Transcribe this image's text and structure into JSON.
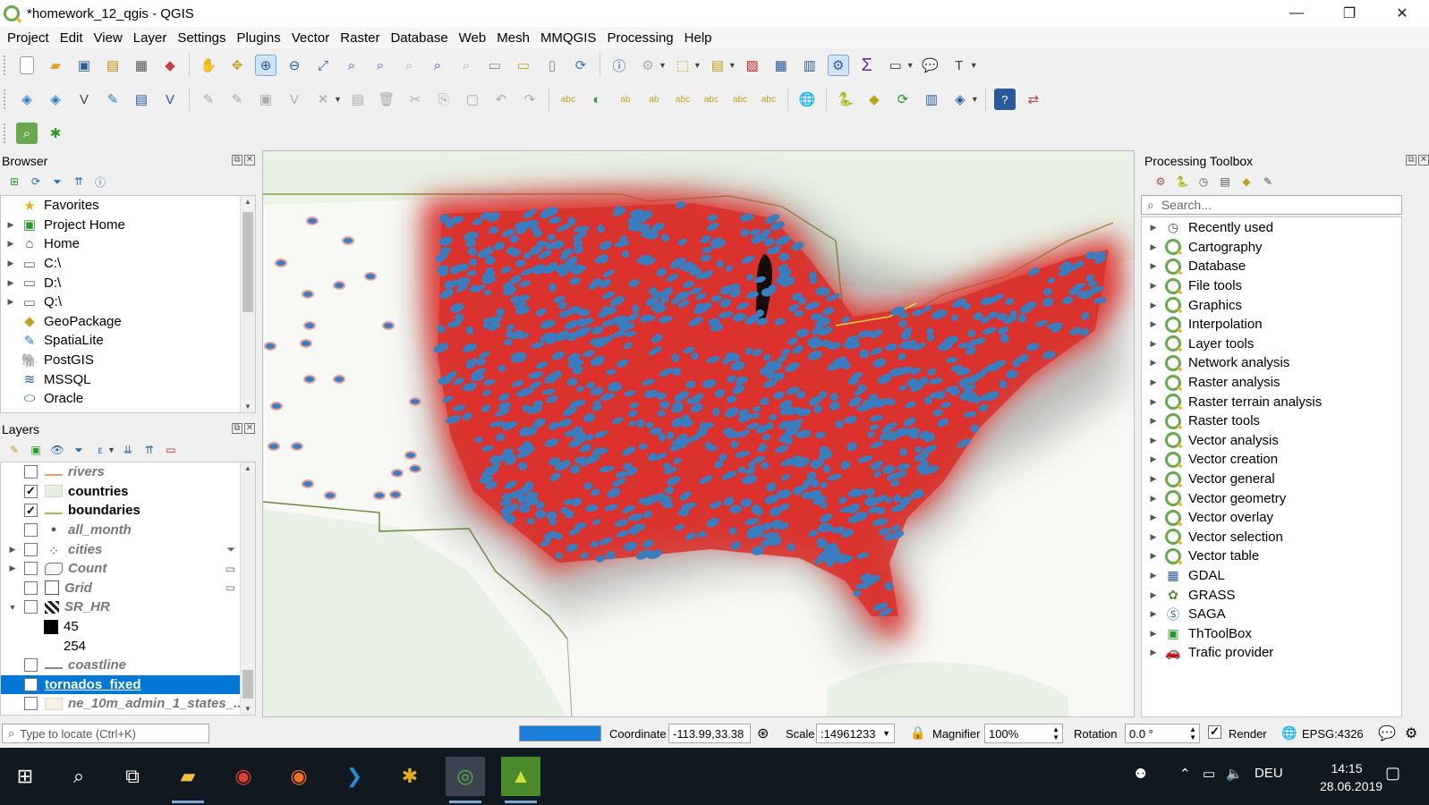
{
  "window": {
    "title": "*homework_12_qgis - QGIS",
    "minimize": "—",
    "maximize": "❐",
    "close": "✕"
  },
  "menu": [
    "Project",
    "Edit",
    "View",
    "Layer",
    "Settings",
    "Plugins",
    "Vector",
    "Raster",
    "Database",
    "Web",
    "Mesh",
    "MMQGIS",
    "Processing",
    "Help"
  ],
  "browser": {
    "title": "Browser",
    "items": [
      {
        "label": "Favorites",
        "icon": "star-icon",
        "expand": false
      },
      {
        "label": "Project Home",
        "icon": "project-home-icon",
        "expand": true
      },
      {
        "label": "Home",
        "icon": "home-icon",
        "expand": true
      },
      {
        "label": "C:\\",
        "icon": "folder-icon",
        "expand": true
      },
      {
        "label": "D:\\",
        "icon": "folder-icon",
        "expand": true
      },
      {
        "label": "Q:\\",
        "icon": "folder-icon",
        "expand": true
      },
      {
        "label": "GeoPackage",
        "icon": "geopackage-icon",
        "expand": false
      },
      {
        "label": "SpatiaLite",
        "icon": "spatialite-icon",
        "expand": false
      },
      {
        "label": "PostGIS",
        "icon": "postgis-icon",
        "expand": false
      },
      {
        "label": "MSSQL",
        "icon": "mssql-icon",
        "expand": false
      },
      {
        "label": "Oracle",
        "icon": "oracle-icon",
        "expand": false
      }
    ]
  },
  "layers": {
    "title": "Layers",
    "items": [
      {
        "label": "rivers",
        "checked": false,
        "style": "italic",
        "sym": "line-orange"
      },
      {
        "label": "countries",
        "checked": true,
        "style": "bold",
        "sym": "fill-green"
      },
      {
        "label": "boundaries",
        "checked": true,
        "style": "bold",
        "sym": "line-olive"
      },
      {
        "label": "all_month",
        "checked": false,
        "style": "italic",
        "sym": "point-gray"
      },
      {
        "label": "cities",
        "checked": false,
        "style": "italic",
        "sym": "points",
        "expand": true,
        "right": "filter-icon"
      },
      {
        "label": "Count",
        "checked": false,
        "style": "italic",
        "sym": "polygon-outline",
        "expand": true,
        "right": "memory-layer-icon"
      },
      {
        "label": "Grid",
        "checked": false,
        "style": "italic",
        "sym": "square-outline",
        "right": "memory-layer-icon"
      },
      {
        "label": "SR_HR",
        "checked": false,
        "style": "italic",
        "sym": "raster",
        "expanded": true
      },
      {
        "label": "45",
        "legend": true,
        "sym": "black-square"
      },
      {
        "label": "254",
        "legend": true,
        "sym": "white-square"
      },
      {
        "label": "coastline",
        "checked": false,
        "style": "italic",
        "sym": "line-gray"
      },
      {
        "label": "tornados_fixed",
        "checked": true,
        "style": "selected",
        "sym": "none"
      },
      {
        "label": "ne_10m_admin_1_states_...",
        "checked": false,
        "style": "italic",
        "sym": "fill-beige"
      }
    ]
  },
  "toolbox": {
    "title": "Processing Toolbox",
    "search_placeholder": "Search...",
    "items": [
      {
        "label": "Recently used",
        "icon": "clock"
      },
      {
        "label": "Cartography",
        "icon": "qgis"
      },
      {
        "label": "Database",
        "icon": "qgis"
      },
      {
        "label": "File tools",
        "icon": "qgis"
      },
      {
        "label": "Graphics",
        "icon": "qgis"
      },
      {
        "label": "Interpolation",
        "icon": "qgis"
      },
      {
        "label": "Layer tools",
        "icon": "qgis"
      },
      {
        "label": "Network analysis",
        "icon": "qgis"
      },
      {
        "label": "Raster analysis",
        "icon": "qgis"
      },
      {
        "label": "Raster terrain analysis",
        "icon": "qgis"
      },
      {
        "label": "Raster tools",
        "icon": "qgis"
      },
      {
        "label": "Vector analysis",
        "icon": "qgis"
      },
      {
        "label": "Vector creation",
        "icon": "qgis"
      },
      {
        "label": "Vector general",
        "icon": "qgis"
      },
      {
        "label": "Vector geometry",
        "icon": "qgis"
      },
      {
        "label": "Vector overlay",
        "icon": "qgis"
      },
      {
        "label": "Vector selection",
        "icon": "qgis"
      },
      {
        "label": "Vector table",
        "icon": "qgis"
      },
      {
        "label": "GDAL",
        "icon": "gdal"
      },
      {
        "label": "GRASS",
        "icon": "grass"
      },
      {
        "label": "SAGA",
        "icon": "saga"
      },
      {
        "label": "ThToolBox",
        "icon": "thtoolbox"
      },
      {
        "label": "Trafic provider",
        "icon": "car"
      }
    ]
  },
  "status": {
    "locate_placeholder": "Type to locate (Ctrl+K)",
    "progress": 1.0,
    "coordinate_label": "Coordinate",
    "coordinate_value": "-113.99,33.38",
    "scale_label": "Scale",
    "scale_value": ":14961233",
    "magnifier_label": "Magnifier",
    "magnifier_value": "100%",
    "rotation_label": "Rotation",
    "rotation_value": "0.0 °",
    "render_label": "Render",
    "crs": "EPSG:4326"
  },
  "taskbar": {
    "language": "DEU",
    "time": "14:15",
    "date": "28.06.2019"
  },
  "colors": {
    "selection": "#0078d7",
    "tornado_point": "#3a7ec0",
    "heat": "#e03a35",
    "accent_green": "#6aa84f"
  }
}
